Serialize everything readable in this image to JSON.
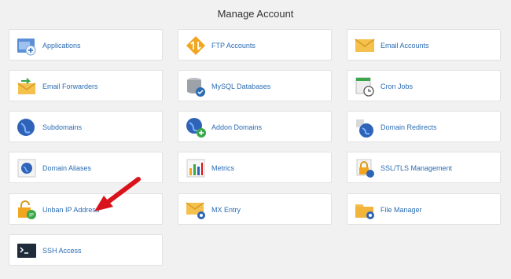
{
  "header": {
    "title": "Manage Account"
  },
  "tiles": [
    {
      "label": "Applications",
      "icon": "applications-icon"
    },
    {
      "label": "FTP Accounts",
      "icon": "ftp-icon"
    },
    {
      "label": "Email Accounts",
      "icon": "email-icon"
    },
    {
      "label": "Email Forwarders",
      "icon": "email-forwarder-icon"
    },
    {
      "label": "MySQL Databases",
      "icon": "database-icon"
    },
    {
      "label": "Cron Jobs",
      "icon": "cron-icon"
    },
    {
      "label": "Subdomains",
      "icon": "globe-icon"
    },
    {
      "label": "Addon Domains",
      "icon": "globe-add-icon"
    },
    {
      "label": "Domain Redirects",
      "icon": "redirect-icon"
    },
    {
      "label": "Domain Aliases",
      "icon": "alias-icon"
    },
    {
      "label": "Metrics",
      "icon": "metrics-icon"
    },
    {
      "label": "SSL/TLS Management",
      "icon": "ssl-icon"
    },
    {
      "label": "Unban IP Address",
      "icon": "unban-ip-icon"
    },
    {
      "label": "MX Entry",
      "icon": "mx-icon"
    },
    {
      "label": "File Manager",
      "icon": "folder-icon"
    },
    {
      "label": "SSH Access",
      "icon": "terminal-icon"
    }
  ],
  "annotation": {
    "icon": "red-arrow-icon"
  },
  "colors": {
    "link": "#2b6cb3",
    "tile_bg": "#ffffff",
    "page_bg": "#f1f1f1",
    "arrow": "#d9121b"
  }
}
